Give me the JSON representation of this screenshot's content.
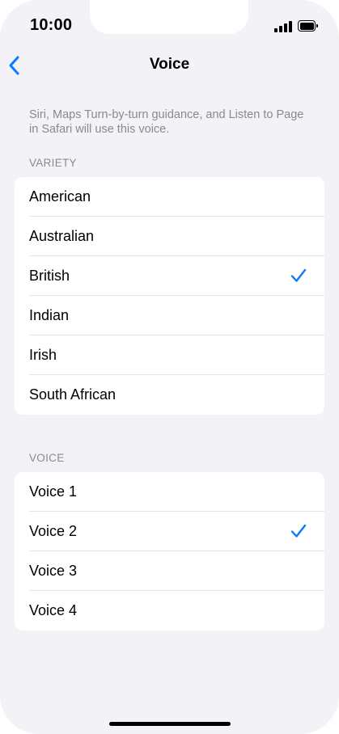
{
  "status_bar": {
    "time": "10:00"
  },
  "nav": {
    "title": "Voice",
    "back_icon": "chevron-left-icon"
  },
  "description": "Siri, Maps Turn-by-turn guidance, and Listen to Page in Safari will use this voice.",
  "variety": {
    "header": "VARIETY",
    "options": [
      {
        "label": "American",
        "selected": false
      },
      {
        "label": "Australian",
        "selected": false
      },
      {
        "label": "British",
        "selected": true
      },
      {
        "label": "Indian",
        "selected": false
      },
      {
        "label": "Irish",
        "selected": false
      },
      {
        "label": "South African",
        "selected": false
      }
    ]
  },
  "voice": {
    "header": "VOICE",
    "options": [
      {
        "label": "Voice 1",
        "selected": false
      },
      {
        "label": "Voice 2",
        "selected": true
      },
      {
        "label": "Voice 3",
        "selected": false
      },
      {
        "label": "Voice 4",
        "selected": false
      }
    ]
  },
  "colors": {
    "accent": "#0a7aff",
    "background": "#f2f2f7",
    "secondary_text": "#8a8a8e"
  }
}
